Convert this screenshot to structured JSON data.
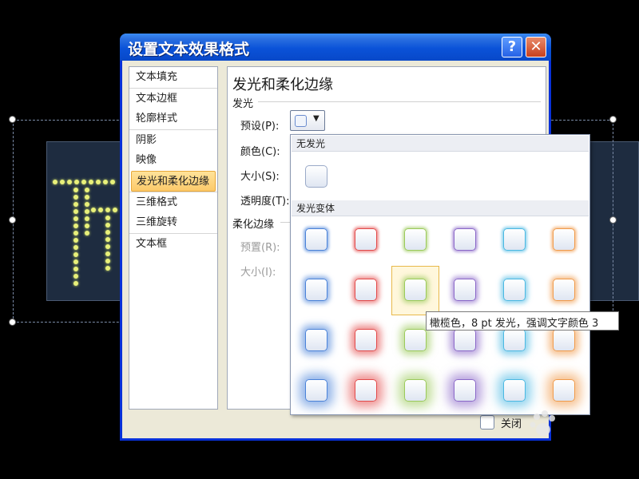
{
  "dialog": {
    "title": "设置文本效果格式",
    "help_glyph": "?",
    "close_glyph": "✕",
    "close_panel_label": "关闭"
  },
  "nav": {
    "items": [
      {
        "label": "文本填充",
        "sep": false,
        "active": false
      },
      {
        "label": "文本边框",
        "sep": true,
        "active": false
      },
      {
        "label": "轮廓样式",
        "sep": false,
        "active": false
      },
      {
        "label": "阴影",
        "sep": true,
        "active": false
      },
      {
        "label": "映像",
        "sep": false,
        "active": false
      },
      {
        "label": "发光和柔化边缘",
        "sep": false,
        "active": true
      },
      {
        "label": "三维格式",
        "sep": true,
        "active": false
      },
      {
        "label": "三维旋转",
        "sep": false,
        "active": false
      },
      {
        "label": "文本框",
        "sep": true,
        "active": false
      }
    ]
  },
  "panel": {
    "title": "发光和柔化边缘",
    "glow_group": "发光",
    "preset_label": "预设(P):",
    "color_label": "颜色(C):",
    "size_label": "大小(S):",
    "transparency_label": "透明度(T):",
    "soft_edge_group": "柔化边缘",
    "soft_preset_label": "预置(R):",
    "soft_size_label": "大小(I):"
  },
  "gallery": {
    "no_glow_header": "无发光",
    "variations_header": "发光变体",
    "row_colors": [
      "#4a82d8",
      "#e24a4a",
      "#9bc95a",
      "#8a68c8",
      "#4ab8e2",
      "#f09a4a"
    ],
    "rows": [
      1,
      2,
      3,
      4
    ],
    "hover_index": 8
  },
  "tooltip": {
    "text": "橄榄色，8 pt 发光，强调文字颜色 3"
  }
}
